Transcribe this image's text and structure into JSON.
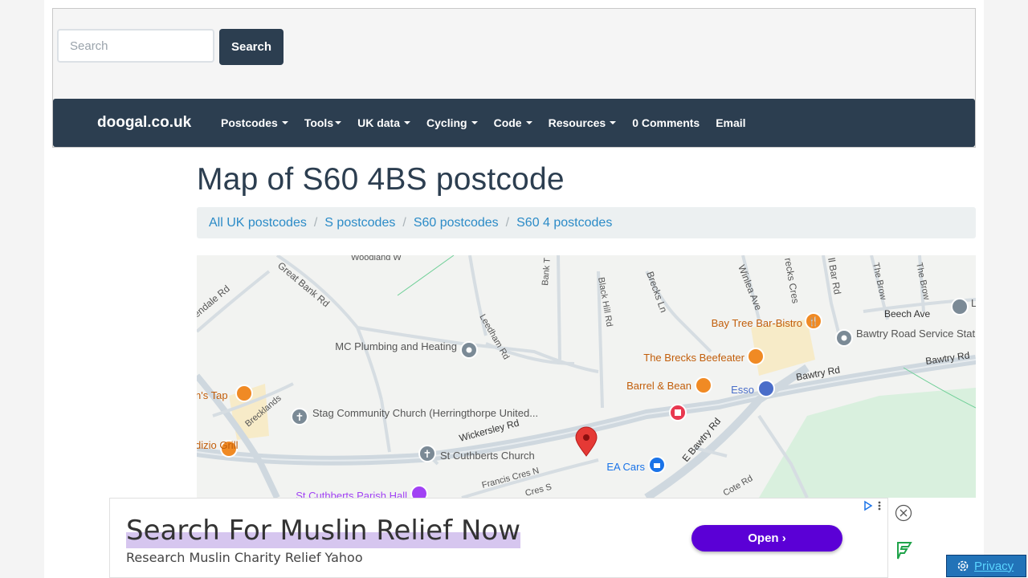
{
  "search": {
    "placeholder": "Search",
    "button_label": "Search"
  },
  "navbar": {
    "brand": "doogal.co.uk",
    "items": [
      {
        "label": "Postcodes",
        "dropdown": true
      },
      {
        "label": "Tools",
        "dropdown": true
      },
      {
        "label": "UK data",
        "dropdown": true
      },
      {
        "label": "Cycling",
        "dropdown": true
      },
      {
        "label": "Code",
        "dropdown": true
      },
      {
        "label": "Resources",
        "dropdown": true
      },
      {
        "label": "0 Comments",
        "dropdown": false
      },
      {
        "label": "Email",
        "dropdown": false
      }
    ]
  },
  "page": {
    "title": "Map of S60 4BS postcode"
  },
  "breadcrumb": [
    "All UK postcodes",
    "S postcodes",
    "S60 postcodes",
    "S60 4 postcodes"
  ],
  "map": {
    "roads": [
      "Woodland W",
      "Great Bank Rd",
      "endale Rd",
      "Leedham Rd",
      "Bank T",
      "Black Hill Rd",
      "Brecks Ln",
      "Winlea Ave",
      "recks Cres",
      "ll Bar Rd",
      "The Brow",
      "The Brow",
      "Beech Ave",
      "Bawtry Rd",
      "Bawtry Rd",
      "Wickersley Rd",
      "Brecklands",
      "E Bawtry Rd",
      "Francis Cres N",
      "Cres S",
      "Cote Rd"
    ],
    "places": [
      "MC Plumbing and Heating",
      "Bay Tree Bar-Bistro",
      "Bawtry Road Service Station",
      "The Brecks Beefeater",
      "Barrel & Bean",
      "Esso",
      "n's Tap",
      "Stag Community Church (Herringthorpe United...",
      "St Cuthberts Church",
      "EA Cars",
      "dizio Grill",
      "St Cuthberts Parish Hall",
      "L"
    ],
    "colors": {
      "food": "#f08a24",
      "church": "#7b8a96",
      "shop": "#1a73e8",
      "music": "#a142f4",
      "hospital": "#e8384f",
      "pin": "#e53935",
      "park": "#d9f0de"
    }
  },
  "ad": {
    "headline": "Search For Muslin Relief Now",
    "sub": "Research Muslin Charity Relief Yahoo",
    "button": "Open",
    "accent": "#5b00d6"
  },
  "privacy": {
    "label": "Privacy"
  }
}
